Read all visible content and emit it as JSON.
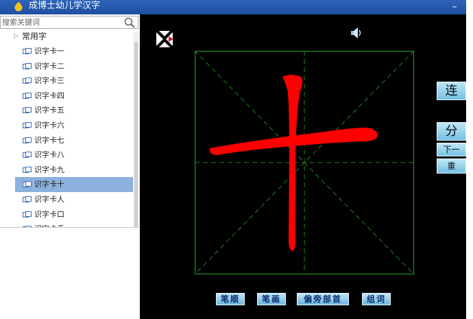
{
  "window": {
    "title": "成博士幼儿学汉字",
    "minimize_label": "–"
  },
  "sidebar": {
    "search": {
      "placeholder": "搜索关键词",
      "value": ""
    },
    "category": "常用字",
    "items": [
      {
        "label": "识字卡一",
        "selected": false
      },
      {
        "label": "识字卡二",
        "selected": false
      },
      {
        "label": "识字卡三",
        "selected": false
      },
      {
        "label": "识字卡四",
        "selected": false
      },
      {
        "label": "识字卡五",
        "selected": false
      },
      {
        "label": "识字卡六",
        "selected": false
      },
      {
        "label": "识字卡七",
        "selected": false
      },
      {
        "label": "识字卡八",
        "selected": false
      },
      {
        "label": "识字卡九",
        "selected": false
      },
      {
        "label": "识字卡十",
        "selected": true
      },
      {
        "label": "识字卡人",
        "selected": false
      },
      {
        "label": "识字卡口",
        "selected": false
      },
      {
        "label": "识字卡手",
        "selected": false
      }
    ]
  },
  "stage": {
    "character": "十",
    "character_color": "#ff0000",
    "grid_color": "#1f8a1f",
    "background": "#000000"
  },
  "side_buttons": {
    "lian": "连",
    "fen": "分",
    "next": "下一",
    "redo": "重"
  },
  "bottom_buttons": {
    "stroke_order": "笔顺",
    "strokes": "笔画",
    "radicals": "偏旁部首",
    "words": "组词"
  },
  "icons": {
    "app": "app-logo-icon",
    "search": "search-icon",
    "card": "card-icon",
    "speaker": "speaker-icon",
    "shuffle": "shuffle-icon"
  }
}
